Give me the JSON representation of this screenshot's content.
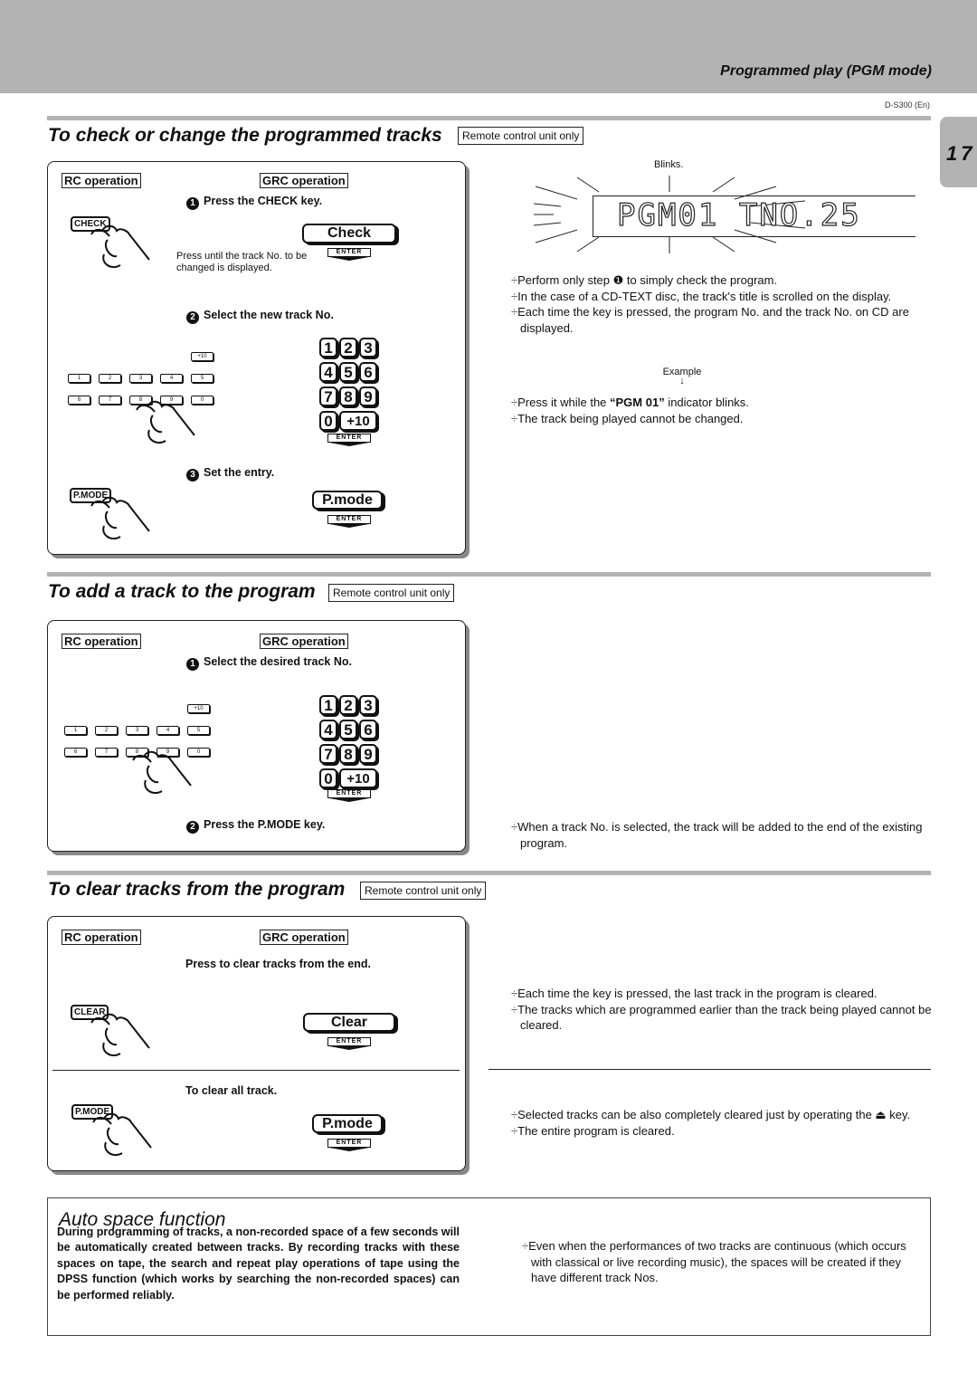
{
  "header": {
    "section_title": "Programmed play (PGM mode)",
    "model": "D-S300 (En)",
    "page_number": "17"
  },
  "check": {
    "title": "To check or change the programmed tracks",
    "tag": "Remote control unit only",
    "rc_label": "RC operation",
    "grc_label": "GRC operation",
    "step1": "Press the CHECK key.",
    "step1_num": "1",
    "rc_key1": "CHECK",
    "grc_btn1": "Check",
    "enter": "ENTER",
    "note1": "Press until the track No. to be changed is displayed.",
    "step2": "Select the new track No.",
    "step2_num": "2",
    "step3": "Set the entry.",
    "step3_num": "3",
    "rc_key3": "P.MODE",
    "grc_btn3": "P.mode",
    "display": {
      "blinks_label": "Blinks.",
      "text_pgm": "PGM01",
      "text_track": "TNO.25"
    },
    "bullets_top": [
      "Perform only step ❶ to simply check the program.",
      "In the case of a CD-TEXT disc, the track's title is scrolled on the display.",
      "Each time the key is pressed, the program No. and the track No. on CD are displayed."
    ],
    "example_label": "Example",
    "example_arrow": "↓",
    "bullets_bottom_1_pre": "Press it while the ",
    "bullets_bottom_1_bold": "“PGM 01”",
    "bullets_bottom_1_post": " indicator blinks.",
    "bullets_bottom_2": "The track being played cannot be changed."
  },
  "keypad": {
    "small_keys_row0": [
      "+10"
    ],
    "small_keys_row1": [
      "1",
      "2",
      "3",
      "4",
      "5"
    ],
    "small_keys_row2": [
      "6",
      "7",
      "8",
      "9",
      "0"
    ],
    "numpad": [
      "1",
      "2",
      "3",
      "4",
      "5",
      "6",
      "7",
      "8",
      "9",
      "0",
      "+10"
    ]
  },
  "add": {
    "title": "To add a track to the program",
    "tag": "Remote control unit only",
    "rc_label": "RC operation",
    "grc_label": "GRC operation",
    "step1_num": "1",
    "step1": "Select the desired track No.",
    "step2_num": "2",
    "step2": "Press the P.MODE key.",
    "enter": "ENTER",
    "bullet": "When a track No. is selected, the track will be added  to the end of the existing program."
  },
  "clear": {
    "title": "To clear tracks from the program",
    "tag": "Remote control unit only",
    "rc_label": "RC operation",
    "grc_label": "GRC operation",
    "instruction": "Press to clear tracks from the end.",
    "rc_key": "CLEAR",
    "grc_btn": "Clear",
    "enter": "ENTER",
    "bullets_top": [
      "Each time the key is pressed, the last track in the  program is cleared.",
      "The tracks which are programmed earlier than the track being played cannot be cleared."
    ],
    "clear_all_label": "To clear all track.",
    "rc_key2": "P.MODE",
    "grc_btn2": "P.mode",
    "bullets_bottom": [
      "Selected tracks can be also completely cleared just by operating the ⏏ key.",
      "The entire program is cleared."
    ]
  },
  "auto_space": {
    "title": "Auto space function",
    "text": "During programming of tracks, a non-recorded space of a few seconds will be automatically created between tracks.  By recording tracks with these spaces on tape, the search and repeat play operations of tape using the DPSS function (which works by searching the non-recorded spaces) can be performed reliably.",
    "note": "Even when the performances of two tracks are continuous (which occurs with classical or live recording music), the spaces will be created if they have different track Nos."
  },
  "bullet_char": "÷"
}
